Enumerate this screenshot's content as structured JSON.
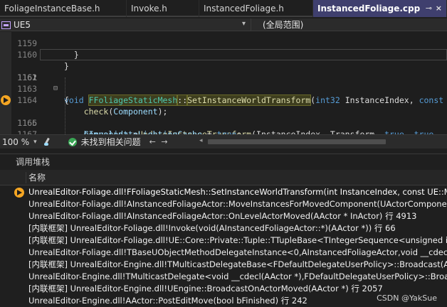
{
  "tabs": [
    {
      "label": "FoliageInstanceBase.h",
      "active": false
    },
    {
      "label": "Invoke.h",
      "active": false
    },
    {
      "label": "InstancedFoliage.h",
      "active": false
    },
    {
      "label": "InstancedFoliage.cpp",
      "active": true
    }
  ],
  "tab_icons": {
    "pin": "⊸",
    "close": "×"
  },
  "navbar": {
    "project": "UE5",
    "scope": "(全局范围)"
  },
  "editor": {
    "lines": [
      {
        "num": "1159",
        "text": "  }"
      },
      {
        "num": "1160",
        "text": "}"
      },
      {
        "num": "1161",
        "text": ""
      },
      {
        "num": "1162",
        "text": "void FFoliageStaticMesh::SetInstanceWorldTransform(int32 InstanceIndex, const"
      },
      {
        "num": "1163",
        "text": "{"
      },
      {
        "num": "1164",
        "text": "    check(Component);"
      },
      {
        "num": "1165",
        "text": "    Component->UpdateInstanceTransform(InstanceIndex, Transform, true, true,"
      },
      {
        "num": "1166",
        "text": "    bInvalidateLightingCache = true;"
      },
      {
        "num": "1167",
        "text": "}"
      }
    ],
    "current_line": "1161",
    "exec_line": "1165"
  },
  "status": {
    "zoom": "100 %",
    "issues": "未找到相关问题",
    "nav_arrows": "← →"
  },
  "callstack": {
    "title": "调用堆栈",
    "column_name": "名称",
    "frames": [
      "UnrealEditor-Foliage.dll!FFoliageStaticMesh::SetInstanceWorldTransform(int InstanceIndex, const UE::Math::TTra",
      "UnrealEditor-Foliage.dll!AInstancedFoliageActor::MoveInstancesForMovedComponent(UActorComponent * InCo",
      "UnrealEditor-Foliage.dll!AInstancedFoliageActor::OnLevelActorMoved(AActor * InActor) 行 4913",
      "[内联框架] UnrealEditor-Foliage.dll!Invoke(void(AInstancedFoliageActor::*)(AActor *)) 行 66",
      "[内联框架] UnrealEditor-Foliage.dll!UE::Core::Private::Tuple::TTupleBase<TIntegerSequence<unsigned int>>::Ap",
      "UnrealEditor-Foliage.dll!TBaseUObjectMethodDelegateInstance<0,AInstancedFoliageActor,void __cdecl(AActor *",
      "[内联框架] UnrealEditor-Engine.dll!TMulticastDelegateBase<FDefaultDelegateUserPolicy>::Broadcast(AActor *)",
      "UnrealEditor-Engine.dll!TMulticastDelegate<void __cdecl(AActor *),FDefaultDelegateUserPolicy>::Broadcast(AAc",
      "[内联框架] UnrealEditor-Engine.dll!UEngine::BroadcastOnActorMoved(AActor *) 行 2057",
      "UnrealEditor-Engine.dll!AActor::PostEditMove(bool bFinished) 行 242"
    ]
  },
  "watermark": "CSDN @YakSue",
  "colors": {
    "active_tab": "#3f3f6e",
    "exec_arrow": "#f5a623",
    "keyword": "#569cd6",
    "function": "#dcdcaa",
    "type": "#4ec9b0"
  }
}
